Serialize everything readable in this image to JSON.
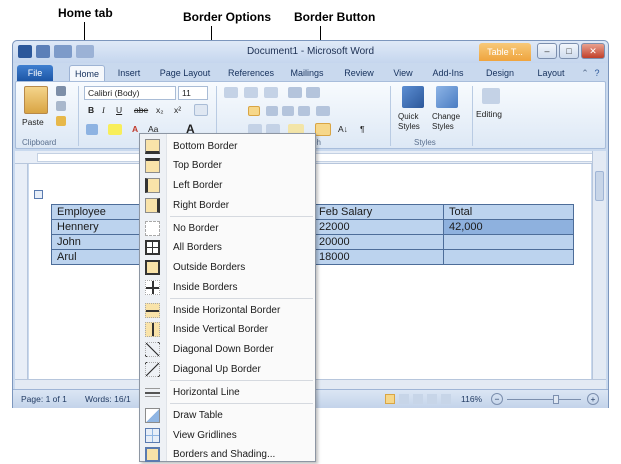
{
  "annotations": {
    "home_tab": "Home tab",
    "border_options": "Border Options",
    "border_button": "Border Button"
  },
  "window": {
    "title": "Document1 - Microsoft Word",
    "contextual_tab": "Table T...",
    "controls": {
      "minimize": "–",
      "maximize": "□",
      "close": "✕"
    }
  },
  "tabs": [
    {
      "label": "File"
    },
    {
      "label": "Home"
    },
    {
      "label": "Insert"
    },
    {
      "label": "Page Layout"
    },
    {
      "label": "References"
    },
    {
      "label": "Mailings"
    },
    {
      "label": "Review"
    },
    {
      "label": "View"
    },
    {
      "label": "Add-Ins"
    },
    {
      "label": "Design"
    },
    {
      "label": "Layout"
    }
  ],
  "ribbon": {
    "paste": "Paste",
    "font_name": "Calibri (Body)",
    "font_size": "11",
    "bold": "B",
    "italic": "I",
    "underline": "U",
    "strike": "abe",
    "subscript": "x₂",
    "superscript": "x²",
    "font_color": "A",
    "change_case": "Aa",
    "grow_font": "A",
    "pilcrow": "¶",
    "sort": "A↓",
    "quick_styles": "Quick Styles",
    "change_styles": "Change Styles",
    "editing": "Editing",
    "groups": {
      "clipboard": "Clipboard",
      "paragraph": "ph",
      "styles": "Styles"
    }
  },
  "table": {
    "rows": [
      [
        "Employee",
        "",
        "Feb Salary",
        "Total"
      ],
      [
        "Hennery",
        "",
        "22000",
        "42,000"
      ],
      [
        "John",
        "",
        "20000",
        ""
      ],
      [
        "Arul",
        "",
        "18000",
        ""
      ]
    ]
  },
  "statusbar": {
    "page": "Page: 1 of 1",
    "words": "Words: 16/1",
    "zoom": "116%",
    "zoom_minus": "−",
    "zoom_plus": "+"
  },
  "menu": {
    "items": [
      {
        "label": "Bottom Border",
        "icon": "bottom-border-icon"
      },
      {
        "label": "Top Border",
        "icon": "top-border-icon"
      },
      {
        "label": "Left Border",
        "icon": "left-border-icon"
      },
      {
        "label": "Right Border",
        "icon": "right-border-icon"
      },
      {
        "label": "No Border",
        "icon": "no-border-icon"
      },
      {
        "label": "All Borders",
        "icon": "all-borders-icon"
      },
      {
        "label": "Outside Borders",
        "icon": "outside-borders-icon"
      },
      {
        "label": "Inside Borders",
        "icon": "inside-borders-icon"
      },
      {
        "label": "Inside Horizontal Border",
        "icon": "inside-horizontal-border-icon"
      },
      {
        "label": "Inside Vertical Border",
        "icon": "inside-vertical-border-icon"
      },
      {
        "label": "Diagonal Down Border",
        "icon": "diagonal-down-border-icon"
      },
      {
        "label": "Diagonal Up Border",
        "icon": "diagonal-up-border-icon"
      },
      {
        "label": "Horizontal Line",
        "icon": "horizontal-line-icon"
      },
      {
        "label": "Draw Table",
        "icon": "draw-table-icon"
      },
      {
        "label": "View Gridlines",
        "icon": "view-gridlines-icon"
      },
      {
        "label": "Borders and Shading...",
        "icon": "borders-shading-icon"
      }
    ]
  },
  "colors": {
    "accent": "#2b579a",
    "table_selection": "#bcd3ee",
    "highlight_icon": "#f6d78a"
  }
}
